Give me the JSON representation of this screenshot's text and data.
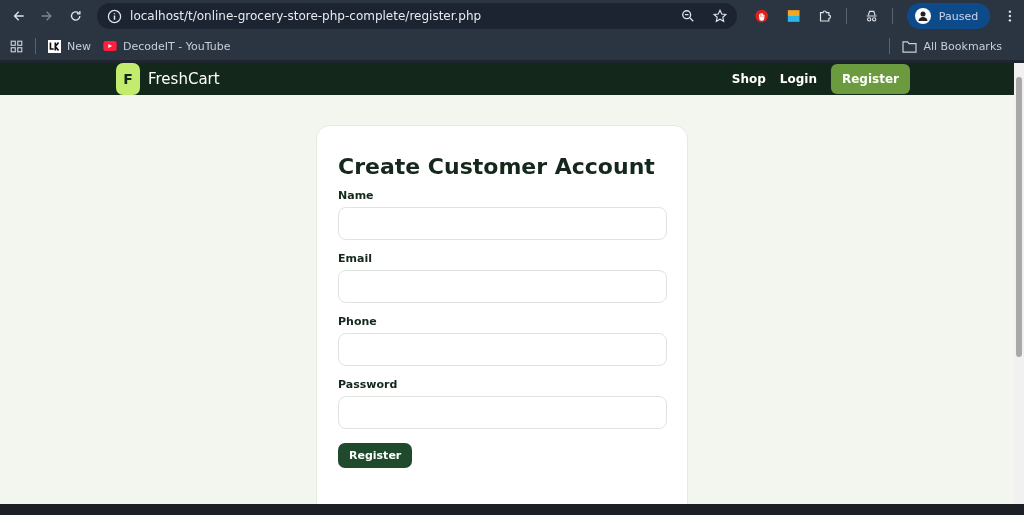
{
  "browser": {
    "url": "localhost/t/online-grocery-store-php-complete/register.php",
    "profile": "Paused",
    "bookmarks": [
      {
        "kind": "site",
        "label": "New"
      },
      {
        "kind": "video",
        "label": "DecodeIT - YouTube"
      }
    ],
    "all_bookmarks": "All Bookmarks"
  },
  "header": {
    "logo_letter": "F",
    "brand": "FreshCart",
    "nav": [
      {
        "label": "Shop",
        "selected": false
      },
      {
        "label": "Login",
        "selected": false
      },
      {
        "label": "Register",
        "selected": true
      }
    ]
  },
  "form": {
    "title": "Create Customer Account",
    "fields": [
      {
        "label": "Name"
      },
      {
        "label": "Email"
      },
      {
        "label": "Phone"
      },
      {
        "label": "Password"
      }
    ],
    "submit": "Register"
  }
}
